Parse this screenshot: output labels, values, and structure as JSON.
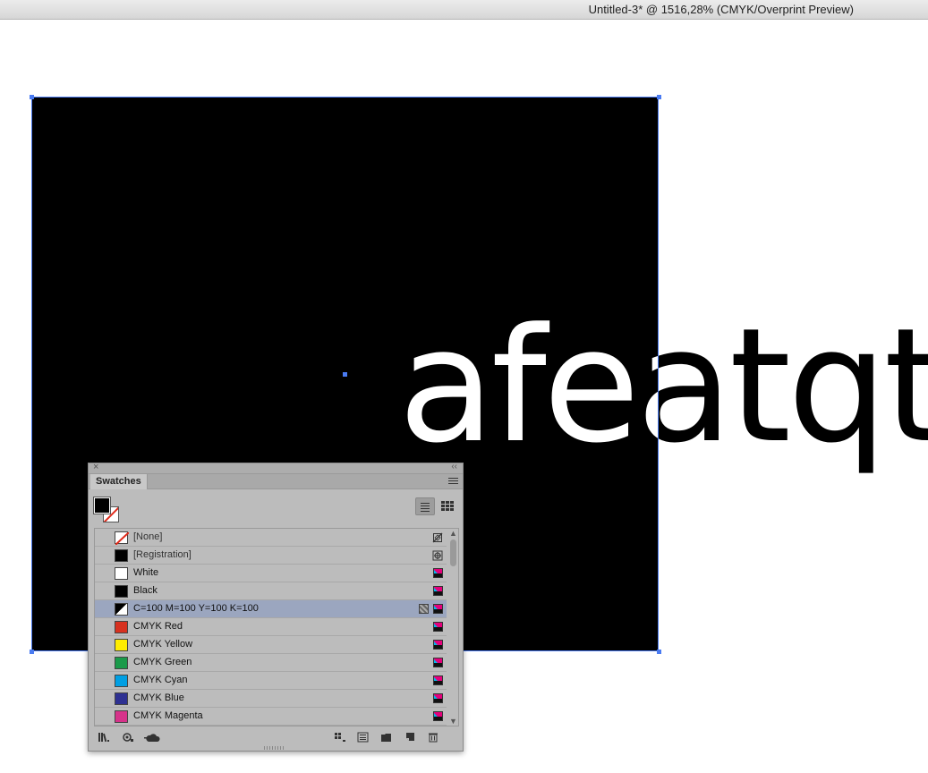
{
  "window": {
    "title": "Untitled-3* @ 1516,28% (CMYK/Overprint Preview)"
  },
  "canvas": {
    "text_content": "afeatqt",
    "colors": {
      "rect_fill": "#000000",
      "selection": "#4a7bf2"
    }
  },
  "swatches_panel": {
    "tab_label": "Swatches",
    "fill_color": "#000000",
    "swatches": [
      {
        "name": "[None]",
        "color": "none",
        "dim": true,
        "mode": "no-edit"
      },
      {
        "name": "[Registration]",
        "color": "#000000",
        "dim": true,
        "mode": "registration"
      },
      {
        "name": "White",
        "color": "#ffffff",
        "mode": "cmyk"
      },
      {
        "name": "Black",
        "color": "#000000",
        "mode": "cmyk"
      },
      {
        "name": "C=100 M=100 Y=100 K=100",
        "color": "#000000",
        "selected": true,
        "mode": "cmyk",
        "has_type_icon": true
      },
      {
        "name": "CMYK Red",
        "color": "#d7311f",
        "mode": "cmyk"
      },
      {
        "name": "CMYK Yellow",
        "color": "#ffed00",
        "mode": "cmyk"
      },
      {
        "name": "CMYK Green",
        "color": "#1a9a4a",
        "mode": "cmyk"
      },
      {
        "name": "CMYK Cyan",
        "color": "#009fe3",
        "mode": "cmyk"
      },
      {
        "name": "CMYK Blue",
        "color": "#2e3192",
        "mode": "cmyk"
      },
      {
        "name": "CMYK Magenta",
        "color": "#d6328a",
        "mode": "cmyk"
      }
    ],
    "icons": {
      "list_view": "list-view-icon",
      "thumb_view": "grid-view-icon",
      "bottom": [
        "libraries-icon",
        "show-kinds-icon",
        "cloud-icon",
        "show-options-icon",
        "swatch-options-icon",
        "new-group-icon",
        "new-swatch-icon",
        "delete-icon"
      ]
    }
  }
}
